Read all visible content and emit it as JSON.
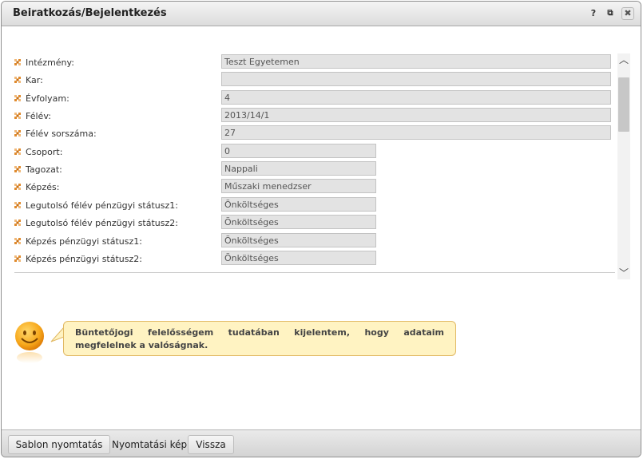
{
  "window": {
    "title": "Beiratkozás/Bejelentkezés",
    "help_icon": "?",
    "popout_icon": "⧉",
    "close_icon": "✖"
  },
  "form": {
    "rows": [
      {
        "label": "Intézmény:",
        "value": "Teszt Egyetemen",
        "width": "wide"
      },
      {
        "label": "Kar:",
        "value": "",
        "width": "wide"
      },
      {
        "label": "Évfolyam:",
        "value": "4",
        "width": "wide"
      },
      {
        "label": "Félév:",
        "value": "2013/14/1",
        "width": "wide"
      },
      {
        "label": "Félév sorszáma:",
        "value": "27",
        "width": "wide"
      },
      {
        "label": "Csoport:",
        "value": "0",
        "width": "narrow"
      },
      {
        "label": "Tagozat:",
        "value": "Nappali",
        "width": "narrow"
      },
      {
        "label": "Képzés:",
        "value": "Műszaki menedzser",
        "width": "narrow"
      },
      {
        "label": "Legutolsó félév pénzügyi státusz1:",
        "value": "Önköltséges",
        "width": "narrow"
      },
      {
        "label": "Legutolsó félév pénzügyi státusz2:",
        "value": "Önköltséges",
        "width": "narrow"
      },
      {
        "label": "Képzés pénzügyi státusz1:",
        "value": "Önköltséges",
        "width": "narrow"
      },
      {
        "label": "Képzés pénzügyi státusz2:",
        "value": "Önköltséges",
        "width": "narrow"
      }
    ]
  },
  "scrollbar": {
    "up_icon": "︿",
    "down_icon": "﹀"
  },
  "notice": {
    "text": "Büntetőjogi felelősségem tudatában kijelentem, hogy adataim megfelelnek a valóságnak."
  },
  "footer": {
    "sablon_label": "Sablon nyomtatás",
    "nyomtatasi_label": "Nyomtatási kép",
    "vissza_label": "Vissza"
  },
  "colors": {
    "bullet": "#e08a2c",
    "field_bg": "#e3e3e3",
    "bubble_bg": "#fff3c2",
    "bubble_border": "#e1b964",
    "smiley": "#f7a81b"
  }
}
